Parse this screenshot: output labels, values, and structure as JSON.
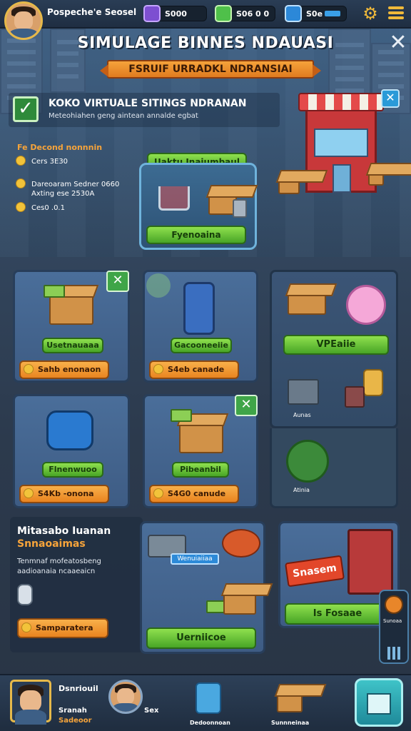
{
  "topbar": {
    "player_name": "Pospeche'e Seosel",
    "res1": "S000",
    "res2": "S06  0 0",
    "res3": "S0e"
  },
  "title": "SIMULAGE BINNES NDAUASI",
  "ribbon": "FSRUIF URRADKL NDRANSIAI",
  "info": {
    "title": "KOKO VIRTUALE SITINGS NDRANAN",
    "subtitle": "Meteohiahen geng aintean annalde egbat"
  },
  "stats": {
    "heading": "Fe Decond nonnnin",
    "row1": "Cers 3E30",
    "row2": "Dareoaram Sedner 0660",
    "row3": "Axting ese 2530A",
    "row4": "Ces0 .0.1"
  },
  "shop_card": {
    "top_button": "Uaktu Inaiumbaul",
    "bottom_button": "Fyenoaina"
  },
  "cards": {
    "c1": {
      "label": "Usetnauaaa",
      "cost": "Sahb enonaon"
    },
    "c2": {
      "label": "Gacooneeiie",
      "cost": "S4eb canade"
    },
    "c3": {
      "label": "Flnenwuoo",
      "cost": "S4Kb -onona"
    },
    "c4": {
      "label": "Pibeanbil",
      "cost": "S4G0 canude"
    }
  },
  "side_panel": {
    "button": "VPEaiie",
    "tag1": "Aunas",
    "tag2": "Atinia"
  },
  "promo": {
    "heading": "Mitasabo Iuanan",
    "heading2": "Snnaoaimas",
    "text": "Tenmnaf mofeatosbeng aadioanaia ncaaeaicn",
    "button": "Samparatera"
  },
  "promo_card": {
    "tag": "Wenuiaiiaa",
    "button": "Uerniicoe"
  },
  "sale_card": {
    "sign": "Snasem",
    "button": "Is Fosaae"
  },
  "side_widget": {
    "label": "Sunoaa"
  },
  "bottom_nav": {
    "name": "Sranah",
    "sub": "Sadeoor",
    "title": "Dsnriouil",
    "rank": "Sex",
    "item3": "Dedoonnoan",
    "item4": "Sunnneinaa"
  },
  "colors": {
    "accent_green": "#48a526",
    "accent_orange": "#e98420",
    "gold": "#f2c33a",
    "panel_blue": "#3e5c84"
  }
}
